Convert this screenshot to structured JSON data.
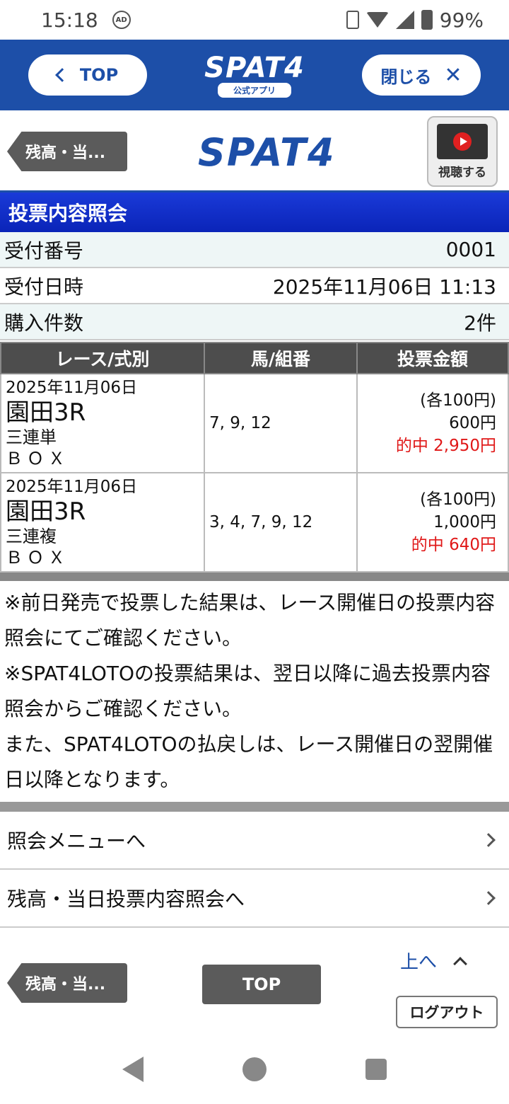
{
  "status": {
    "time": "15:18",
    "ad": "AD",
    "battery": "99%"
  },
  "appbar": {
    "top_label": "TOP",
    "logo": "SPAT4",
    "logo_sub": "公式アプリ",
    "close_label": "閉じる",
    "close_glyph": "✕"
  },
  "site": {
    "back_label": "残高・当...",
    "logo": "SPAT4",
    "watch_label": "視聴する"
  },
  "section_title": "投票内容照会",
  "info": {
    "receipt_label": "受付番号",
    "receipt_value": "0001",
    "datetime_label": "受付日時",
    "datetime_value": "2025年11月06日 11:13",
    "count_label": "購入件数",
    "count_value": "2件"
  },
  "table": {
    "headers": [
      "レース/式別",
      "馬/組番",
      "投票金額"
    ],
    "rows": [
      {
        "date": "2025年11月06日",
        "venue": "園田3R",
        "bet_type": "三連単",
        "box": "ＢＯＸ",
        "horses": "7, 9, 12",
        "unit": "(各100円)",
        "amount": "600円",
        "hit": "的中  2,950円"
      },
      {
        "date": "2025年11月06日",
        "venue": "園田3R",
        "bet_type": "三連複",
        "box": "ＢＯＸ",
        "horses": "3, 4, 7, 9, 12",
        "unit": "(各100円)",
        "amount": "1,000円",
        "hit": "的中  640円"
      }
    ]
  },
  "notes": {
    "n1": "※前日発売で投票した結果は、レース開催日の投票内容照会にてご確認ください。",
    "n2": "※SPAT4LOTOの投票結果は、翌日以降に過去投票内容照会からご確認ください。",
    "n3": "また、SPAT4LOTOの払戻しは、レース開催日の翌開催日以降となります。"
  },
  "menu": {
    "item1": "照会メニューへ",
    "item2": "残高・当日投票内容照会へ"
  },
  "footer": {
    "back_label": "残高・当...",
    "top_label": "TOP",
    "up_label": "上へ",
    "logout_label": "ログアウト"
  },
  "colors": {
    "brand": "#1d4fa8",
    "section": "#0a24b8",
    "hit": "#e01818"
  }
}
